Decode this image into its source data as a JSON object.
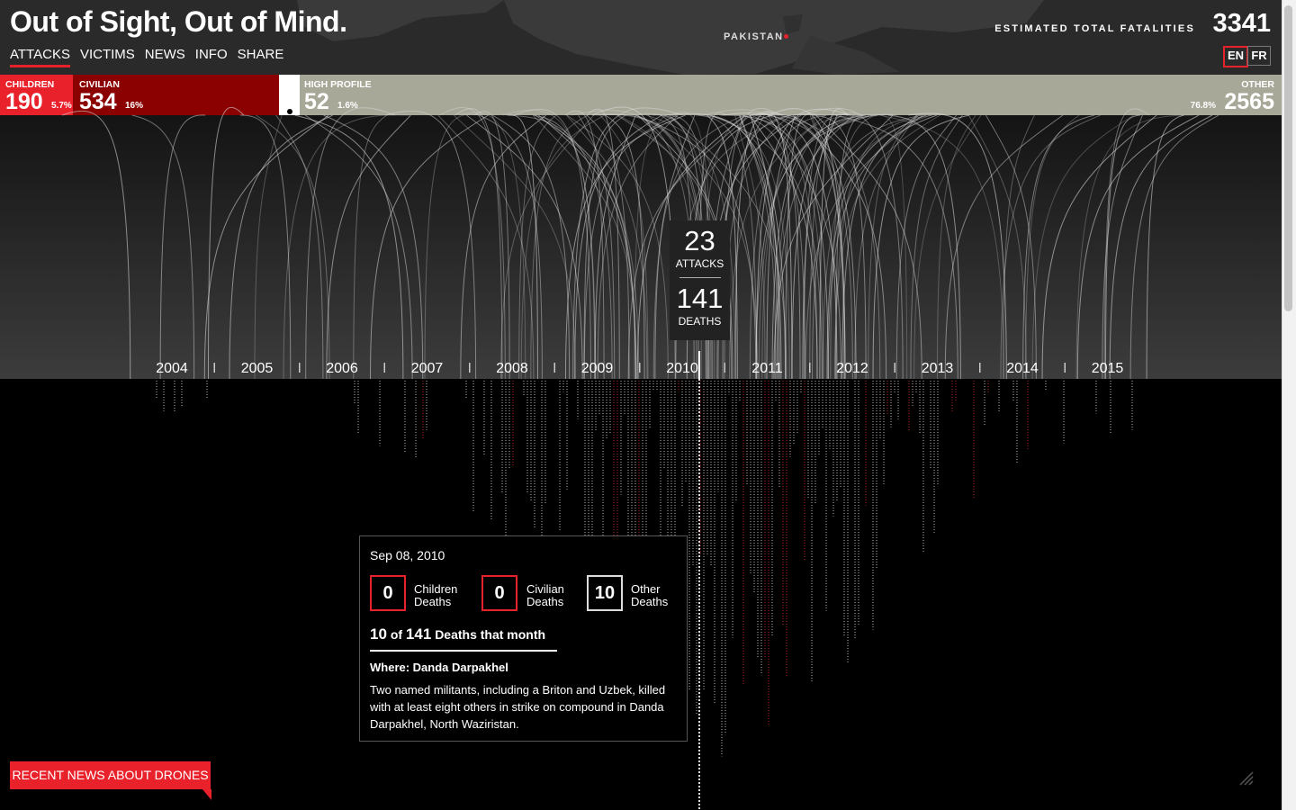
{
  "header": {
    "title": "Out of Sight, Out of Mind.",
    "nav": [
      "ATTACKS",
      "VICTIMS",
      "NEWS",
      "INFO",
      "SHARE"
    ],
    "map_label": "PAKISTAN",
    "estimated_label": "ESTIMATED TOTAL FATALITIES",
    "total": "3341",
    "lang": [
      "EN",
      "FR"
    ]
  },
  "categories": {
    "children": {
      "label": "CHILDREN",
      "value": "190",
      "pct": "5.7%"
    },
    "civilian": {
      "label": "CIVILIAN",
      "value": "534",
      "pct": "16%"
    },
    "high_profile": {
      "label": "HIGH PROFILE",
      "value": "52",
      "pct": "1.6%"
    },
    "other": {
      "label": "OTHER",
      "value": "2565",
      "pct": "76.8%"
    }
  },
  "timeline": {
    "years": [
      "2004",
      "2005",
      "2006",
      "2007",
      "2008",
      "2009",
      "2010",
      "2011",
      "2012",
      "2013",
      "2014",
      "2015"
    ]
  },
  "month_summary": {
    "attacks": "23",
    "attacks_label": "ATTACKS",
    "deaths": "141",
    "deaths_label": "DEATHS"
  },
  "tooltip": {
    "date": "Sep 08, 2010",
    "children": "0",
    "children_label": "Children Deaths",
    "civilian": "0",
    "civilian_label": "Civilian Deaths",
    "other": "10",
    "other_label": "Other Deaths",
    "deaths": "10",
    "of": "of",
    "month_total": "141",
    "month_text": "Deaths that month",
    "where": "Where: Danda Darpakhel",
    "description": "Two named militants, including a Briton and Uzbek, killed with at least eight others in strike on compound in Danda Darpakhel, North Waziristan."
  },
  "news_button": "RECENT NEWS ABOUT DRONES",
  "colors": {
    "accent": "#e8212b",
    "children": "#e8212b",
    "civilian": "#8b0000",
    "high_profile": "#ffffff",
    "other": "#a8a899"
  }
}
